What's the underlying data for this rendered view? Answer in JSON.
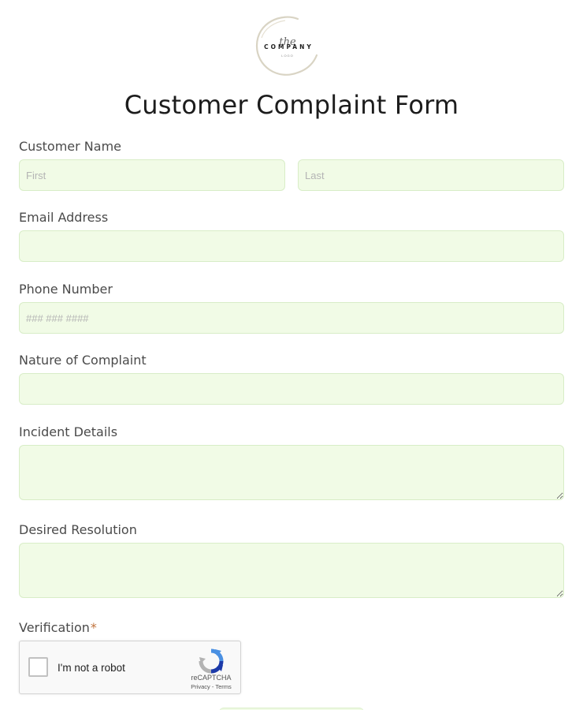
{
  "logo": {
    "script": "the",
    "company": "COMPANY",
    "sub": "LOGO"
  },
  "form": {
    "title": "Customer Complaint Form",
    "customer_name": {
      "label": "Customer Name",
      "first_placeholder": "First",
      "last_placeholder": "Last",
      "first_value": "",
      "last_value": ""
    },
    "email": {
      "label": "Email Address",
      "value": "",
      "placeholder": ""
    },
    "phone": {
      "label": "Phone Number",
      "value": "",
      "placeholder": "### ### ####"
    },
    "nature": {
      "label": "Nature of Complaint",
      "value": "",
      "placeholder": ""
    },
    "incident": {
      "label": "Incident Details",
      "value": "",
      "placeholder": ""
    },
    "resolution": {
      "label": "Desired Resolution",
      "value": "",
      "placeholder": ""
    },
    "verification": {
      "label": "Verification",
      "required_mark": "*"
    }
  },
  "captcha": {
    "checkbox_label": "I'm not a robot",
    "brand": "reCAPTCHA",
    "links": "Privacy - Terms"
  },
  "colors": {
    "field_bg": "#f1fbe6",
    "field_border": "#d8edc7",
    "required": "#c0723b",
    "title": "#1c1c1c"
  }
}
